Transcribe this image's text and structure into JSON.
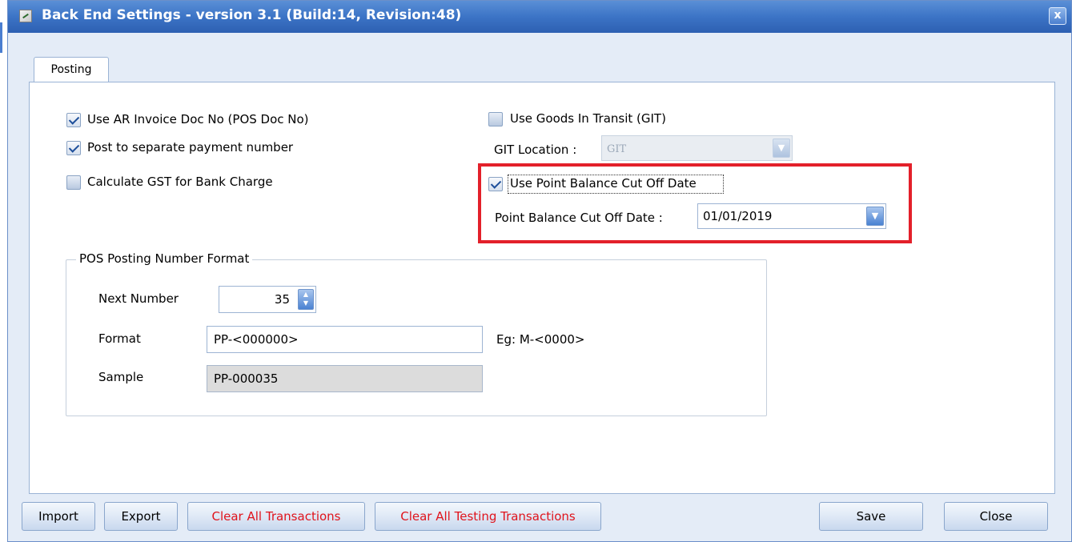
{
  "window": {
    "title": "Back End Settings - version 3.1 (Build:14, Revision:48)",
    "close_glyph": "x"
  },
  "tabs": [
    {
      "label": "Posting",
      "selected": true
    }
  ],
  "options": {
    "use_ar_invoice": {
      "label": "Use AR Invoice Doc No (POS Doc No)",
      "checked": true
    },
    "post_separate_payment": {
      "label": "Post to separate payment number",
      "checked": true
    },
    "calc_gst_bank_charge": {
      "label": "Calculate GST for Bank Charge",
      "checked": false
    },
    "use_git": {
      "label": "Use Goods In Transit (GIT)",
      "checked": false
    },
    "git_location": {
      "label": "GIT Location :",
      "value": "GIT",
      "enabled": false
    },
    "use_point_balance": {
      "label": "Use Point Balance Cut Off Date",
      "checked": true
    },
    "point_balance_date": {
      "label": "Point Balance Cut Off Date :",
      "value": "01/01/2019"
    }
  },
  "posting_format": {
    "group_title": "POS Posting Number Format",
    "next_number_label": "Next Number",
    "next_number_value": "35",
    "format_label": "Format",
    "format_value": "PP-<000000>",
    "format_hint": "Eg: M-<0000>",
    "sample_label": "Sample",
    "sample_value": "PP-000035"
  },
  "buttons": {
    "import": "Import",
    "export": "Export",
    "clear_all": "Clear All Transactions",
    "clear_testing": "Clear All Testing Transactions",
    "save": "Save",
    "close": "Close"
  },
  "colors": {
    "titlebar": "#3c74c6",
    "highlight_border": "#e3202a",
    "danger_text": "#e0141c"
  }
}
